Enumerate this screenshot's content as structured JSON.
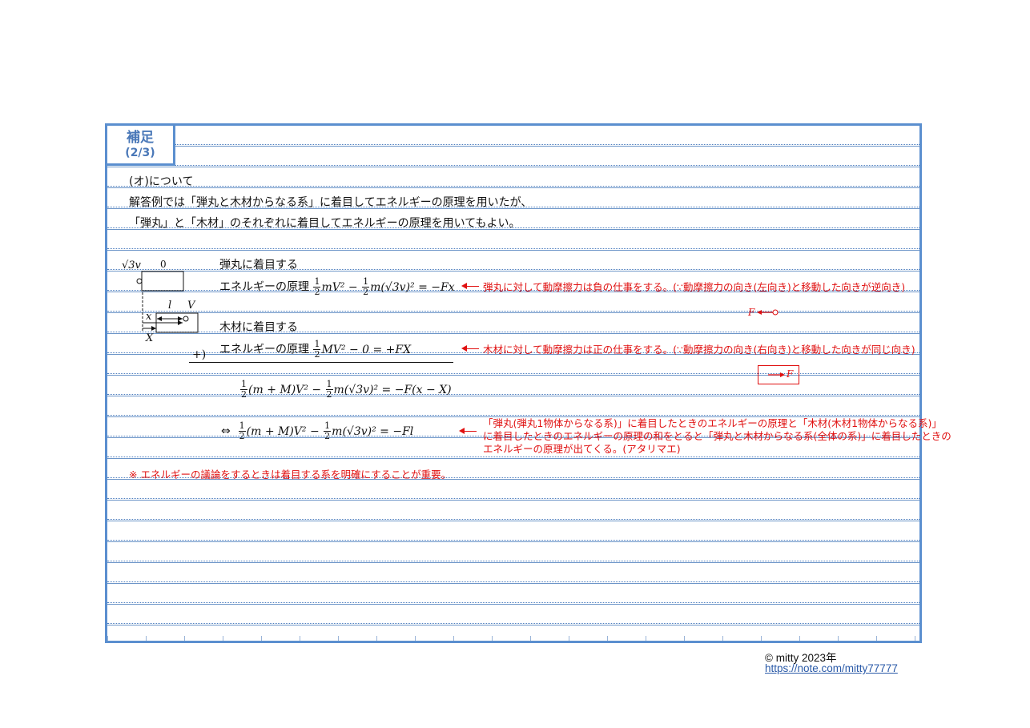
{
  "header": {
    "title": "補足",
    "page": "(2/3)"
  },
  "intro": [
    "(オ)について",
    "解答例では「弾丸と木材からなる系」に着目してエネルギーの原理を用いたが、",
    "「弾丸」と「木材」のそれぞれに着目してエネルギーの原理を用いてもよい。"
  ],
  "figure": {
    "v_label": "√3v",
    "zero_label": "0",
    "l_label": "l",
    "V_label": "V",
    "x_label": "x",
    "X_label": "X"
  },
  "bullet": {
    "heading": "弾丸に着目する",
    "principle_label": "エネルギーの原理",
    "equation_rhs": "= −Fx",
    "note": "弾丸に対して動摩擦力は負の仕事をする。(∵動摩擦力の向き(左向き)と移動した向きが逆向き)",
    "force_label": "F"
  },
  "wood": {
    "heading": "木材に着目する",
    "principle_label": "エネルギーの原理",
    "equation_rhs": "MV² − 0 = +FX",
    "note": "木材に対して動摩擦力は正の仕事をする。(∵動摩擦力の向き(右向き)と移動した向きが同じ向き)",
    "force_label": "F"
  },
  "sum": {
    "plus_label": "+)",
    "eq1": "(m + M)V² − ",
    "eq1_tail": "m(√3v)² = −F(x − X)",
    "iff": "⇔",
    "eq2": "(m + M)V² − ",
    "eq2_tail": "m(√3v)² = −Fl",
    "note_lines": [
      "「弾丸(弾丸1物体からなる系)」に着目したときのエネルギーの原理と「木材(木材1物体からなる系)」",
      "に着目したときのエネルギーの原理の和をとると「弾丸と木材からなる系(全体の系)」に着目したときの",
      "エネルギーの原理が出てくる。(アタリマエ)"
    ]
  },
  "caution": "※ エネルギーの議論をするときは着目する系を明確にすることが重要。",
  "footer": {
    "copyright": "© mitty 2023年",
    "link": "https://note.com/mitty77777"
  },
  "colors": {
    "frame": "#5b8fcf",
    "accent_red": "#e01010"
  }
}
